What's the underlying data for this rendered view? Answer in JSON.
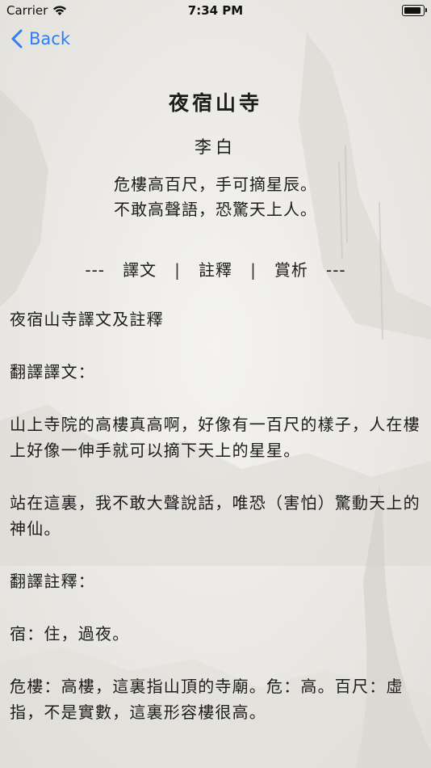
{
  "status_bar": {
    "carrier": "Carrier",
    "time": "7:34 PM"
  },
  "nav": {
    "back_label": "Back",
    "accent": "#2f7cf6"
  },
  "poem": {
    "title": "夜宿山寺",
    "author": "李白",
    "lines": [
      "危樓高百尺，手可摘星辰。",
      "不敢高聲語，恐驚天上人。"
    ]
  },
  "tabs": {
    "left_dashes": "---",
    "right_dashes": "---",
    "separator": "|",
    "items": [
      "譯文",
      "註釋",
      "賞析"
    ]
  },
  "article": {
    "heading": "夜宿山寺譯文及註釋",
    "translation_label": "翻譯譯文：",
    "translation_p1": "山上寺院的高樓真高啊，好像有一百尺的樣子，人在樓上好像一伸手就可以摘下天上的星星。",
    "translation_p2": "站在這裏，我不敢大聲說話，唯恐（害怕）驚動天上的神仙。",
    "notes_label": "翻譯註釋：",
    "note_1": "宿：住，過夜。",
    "note_2": "危樓：高樓，這裏指山頂的寺廟。危：高。百尺：虛指，不是實數，這裏形容樓很高。"
  },
  "colors": {
    "background": "#eceae6",
    "text": "#1c1c1c"
  }
}
